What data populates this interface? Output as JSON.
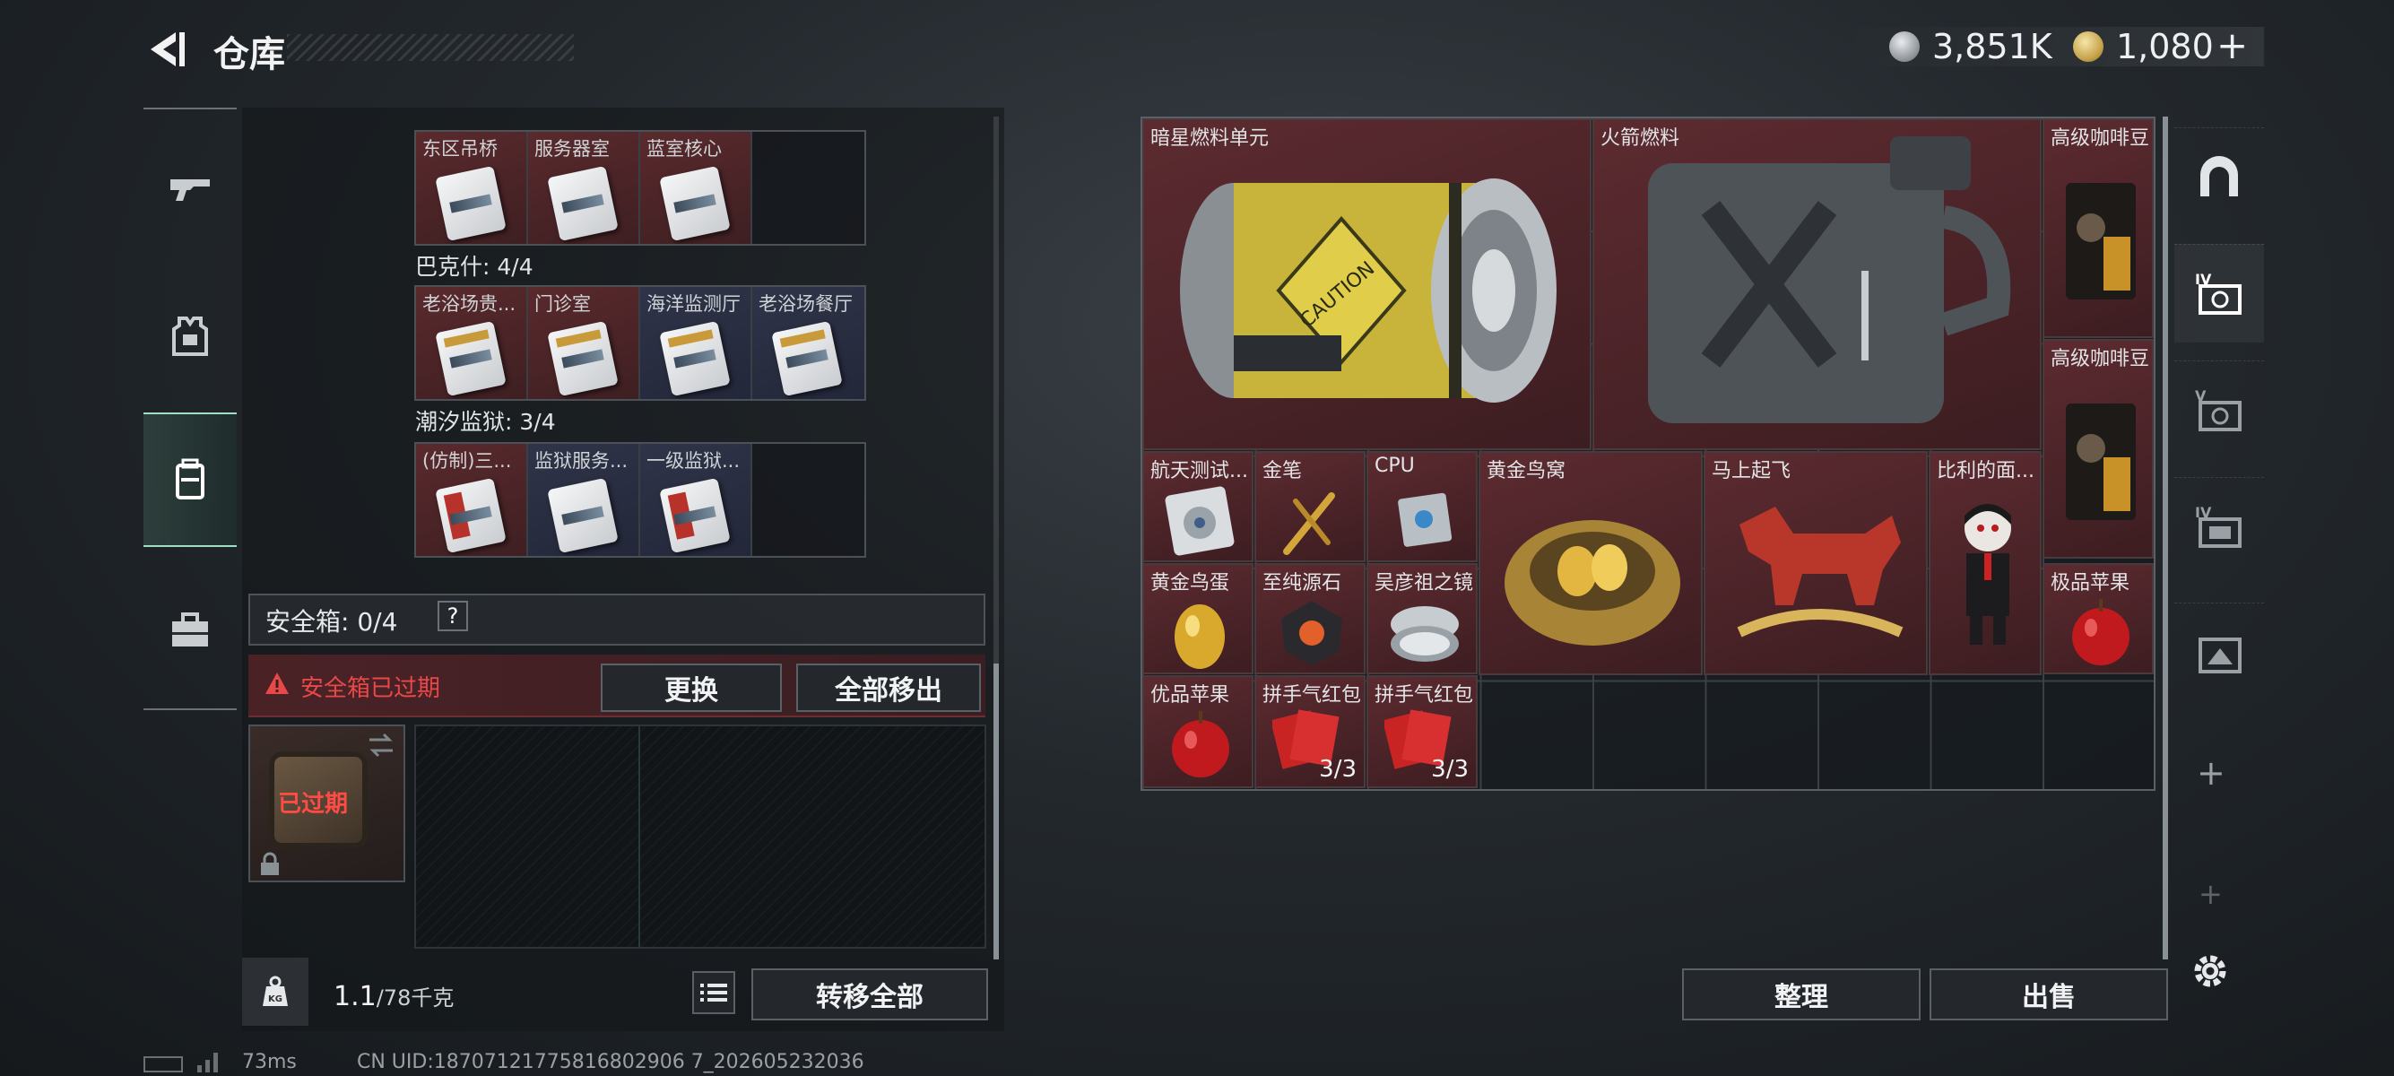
{
  "header": {
    "title": "仓库"
  },
  "currency": {
    "silver": "3,851K",
    "gold": "1,080",
    "add_symbol": "+"
  },
  "left_rail": [
    {
      "name": "rail-weapons",
      "icon": "gun-icon",
      "active": false
    },
    {
      "name": "rail-gear",
      "icon": "armor-icon",
      "active": false
    },
    {
      "name": "rail-backpack",
      "icon": "backpack-icon",
      "active": true
    },
    {
      "name": "rail-case",
      "icon": "briefcase-icon",
      "active": false
    }
  ],
  "keycard_groups": [
    {
      "label": "",
      "cards": [
        {
          "name": "东区吊桥",
          "tone": "red",
          "card": "plain"
        },
        {
          "name": "服务器室",
          "tone": "red",
          "card": "plain"
        },
        {
          "name": "蓝室核心",
          "tone": "red",
          "card": "plain"
        },
        {
          "name": "",
          "tone": "empty",
          "card": "none"
        }
      ]
    },
    {
      "label": "巴克什: 4/4",
      "cards": [
        {
          "name": "老浴场贵...",
          "tone": "red",
          "card": "gold"
        },
        {
          "name": "门诊室",
          "tone": "red",
          "card": "gold"
        },
        {
          "name": "海洋监测厅",
          "tone": "blue",
          "card": "gold"
        },
        {
          "name": "老浴场餐厅",
          "tone": "blue",
          "card": "gold"
        }
      ]
    },
    {
      "label": "潮汐监狱: 3/4",
      "cards": [
        {
          "name": "(仿制)三...",
          "tone": "red",
          "card": "redc"
        },
        {
          "name": "监狱服务...",
          "tone": "blue",
          "card": "plain"
        },
        {
          "name": "一级监狱...",
          "tone": "blue",
          "card": "redc"
        },
        {
          "name": "",
          "tone": "empty",
          "card": "none"
        }
      ]
    }
  ],
  "safe_box": {
    "label": "安全箱: 0/4",
    "help": "?",
    "expired_text": "安全箱已过期",
    "replace_label": "更换",
    "remove_all_label": "全部移出",
    "case_status": "已过期"
  },
  "weight": {
    "current": "1.1",
    "max": "/78千克",
    "icon_text": "KG"
  },
  "transfer_all_label": "转移全部",
  "stash_items": [
    {
      "name": "暗星燃料单元",
      "count": ""
    },
    {
      "name": "火箭燃料",
      "count": ""
    },
    {
      "name": "高级咖啡豆",
      "count": ""
    },
    {
      "name": "高级咖啡豆",
      "count": ""
    },
    {
      "name": "航天测试...",
      "count": ""
    },
    {
      "name": "金笔",
      "count": ""
    },
    {
      "name": "CPU",
      "count": ""
    },
    {
      "name": "黄金鸟窝",
      "count": ""
    },
    {
      "name": "马上起飞",
      "count": ""
    },
    {
      "name": "比利的面...",
      "count": ""
    },
    {
      "name": "黄金鸟蛋",
      "count": ""
    },
    {
      "name": "至纯源石",
      "count": ""
    },
    {
      "name": "吴彦祖之镜",
      "count": ""
    },
    {
      "name": "极品苹果",
      "count": ""
    },
    {
      "name": "优品苹果",
      "count": ""
    },
    {
      "name": "拼手气红包",
      "count": "3/3"
    },
    {
      "name": "拼手气红包",
      "count": "3/3"
    }
  ],
  "actions": {
    "sort_label": "整理",
    "sell_label": "出售"
  },
  "right_rail": [
    {
      "name": "rrail-overview",
      "icon": "arch-icon",
      "label": ""
    },
    {
      "name": "rrail-tier4",
      "icon": "stash-tier-icon",
      "label": "IV"
    },
    {
      "name": "rrail-tier5",
      "icon": "stash-tier-icon",
      "label": "V"
    },
    {
      "name": "rrail-tier4b",
      "icon": "stash-tier-icon",
      "label": "IV"
    },
    {
      "name": "rrail-tier3",
      "icon": "stash-tier-icon",
      "label": ""
    }
  ],
  "footer": {
    "ping": "73ms",
    "uid": "CN UID:18707121775816802906 7_202605232036"
  }
}
